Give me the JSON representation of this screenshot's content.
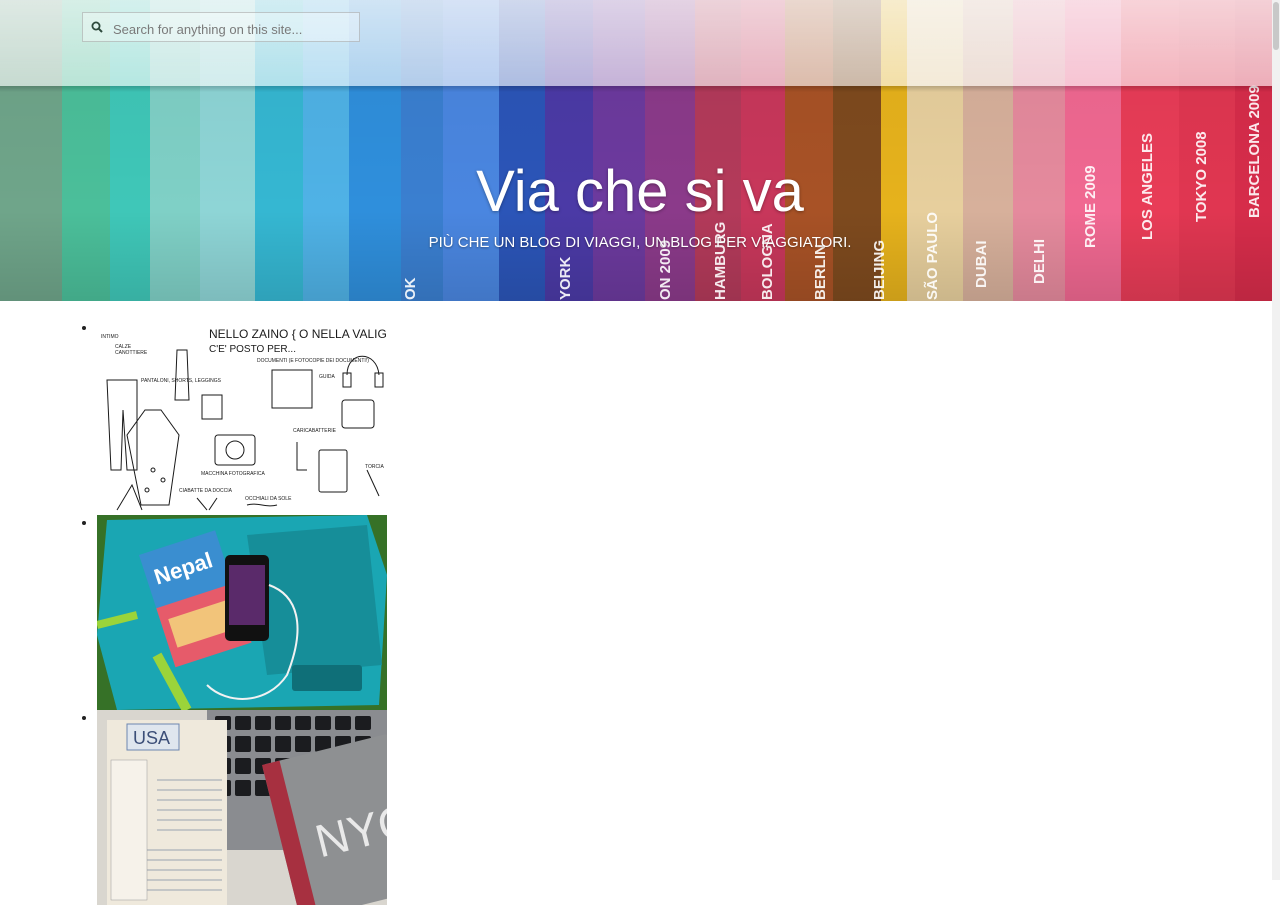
{
  "search": {
    "placeholder": "Search for anything on this site..."
  },
  "site": {
    "title": "Via che si va",
    "tagline": "PIÙ CHE UN BLOG DI VIAGGI, UN BLOG PER VIAGGIATORI."
  },
  "hero": {
    "book_spines": [
      "OK",
      "YORK",
      "ON 2009",
      "HAMBURG",
      "BOLOGNA",
      "BERLIN",
      "BEIJING",
      "SÃO PAULO",
      "DUBAI",
      "DELHI",
      "ROME 2009",
      "LOS ANGELES",
      "TOKYO 2008",
      "BARCELONA 2009"
    ]
  },
  "gallery": {
    "items": [
      {
        "alt": "Illustrated packing list sketch",
        "sketch_texts": {
          "heading": "NELLO ZAINO  { O NELLA VALIGIA }",
          "sub": "C'E' POSTO PER...",
          "left1": "INTIMO",
          "left2": "CALZE",
          "left3": "CANOTTIERE",
          "pants": "PANTALONI, SHORTS, LEGGINGS",
          "docs": "DOCUMENTI (E FOTOCOPIE DEI DOCUMENTI!)",
          "guide": "GUIDA",
          "camera": "MACCHINA FOTOGRAFICA",
          "shoes": "CIABATTE DA DOCCIA",
          "glasses": "OCCHIALI DA SOLE",
          "charger": "CARICABATTERIE",
          "torch": "TORCIA"
        }
      },
      {
        "alt": "Teal backpack with Nepal guidebook and phone",
        "book_title": "Nepal"
      },
      {
        "alt": "Laptop keyboard with USA notebook and NYC guide",
        "notebook_label": "USA",
        "guide_label": "NYC"
      }
    ]
  },
  "colors": {
    "title_text": "#ffffff",
    "topbar_tint": "#ffffff",
    "search_icon": "#2e4a3c",
    "backpack": "#1aa6b3",
    "grass": "#3d7a2a"
  }
}
